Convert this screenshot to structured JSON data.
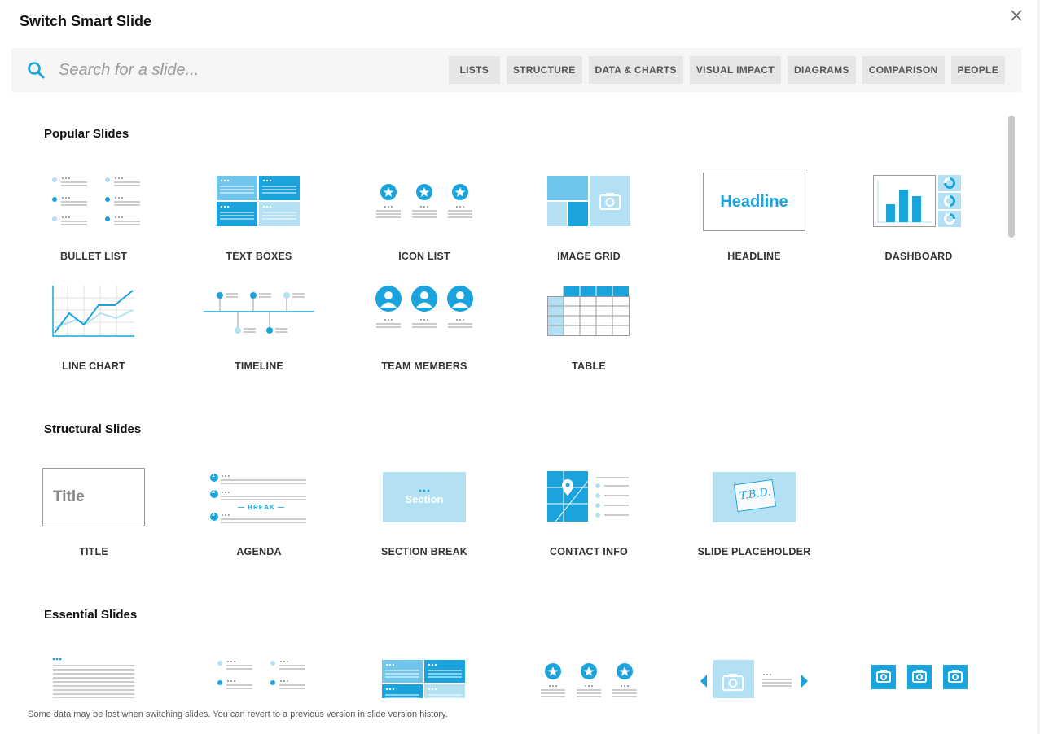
{
  "modal": {
    "title": "Switch Smart Slide"
  },
  "search": {
    "placeholder": "Search for a slide..."
  },
  "filters": [
    "LISTS",
    "STRUCTURE",
    "DATA & CHARTS",
    "VISUAL IMPACT",
    "DIAGRAMS",
    "COMPARISON",
    "PEOPLE"
  ],
  "sections": {
    "popular": {
      "title": "Popular Slides",
      "tiles": [
        "BULLET LIST",
        "TEXT BOXES",
        "ICON LIST",
        "IMAGE GRID",
        "HEADLINE",
        "DASHBOARD",
        "LINE CHART",
        "TIMELINE",
        "TEAM MEMBERS",
        "TABLE"
      ]
    },
    "structural": {
      "title": "Structural Slides",
      "tiles": [
        "TITLE",
        "AGENDA",
        "SECTION BREAK",
        "CONTACT INFO",
        "SLIDE PLACEHOLDER"
      ]
    },
    "essential": {
      "title": "Essential Slides"
    }
  },
  "thumb_text": {
    "headline": "Headline",
    "title": "Title",
    "agenda_break": "— BREAK —",
    "agenda_numbers": [
      "1",
      "2",
      "3"
    ],
    "section": "Section",
    "tbd": "T.B.D."
  },
  "footer": {
    "note": "Some data may be lost when switching slides. You can revert to a previous version in slide version history."
  },
  "colors": {
    "accent": "#1aa3dc",
    "accent_light": "#b3e0f2",
    "accent_mid": "#6fc6ea",
    "line": "#9a9a9a"
  },
  "icons": {
    "search": "search-icon",
    "close": "close-icon",
    "star": "star-icon",
    "camera": "camera-icon",
    "person": "person-icon",
    "pin": "map-pin-icon",
    "arrow_left": "arrow-left-icon",
    "arrow_right": "arrow-right-icon"
  }
}
